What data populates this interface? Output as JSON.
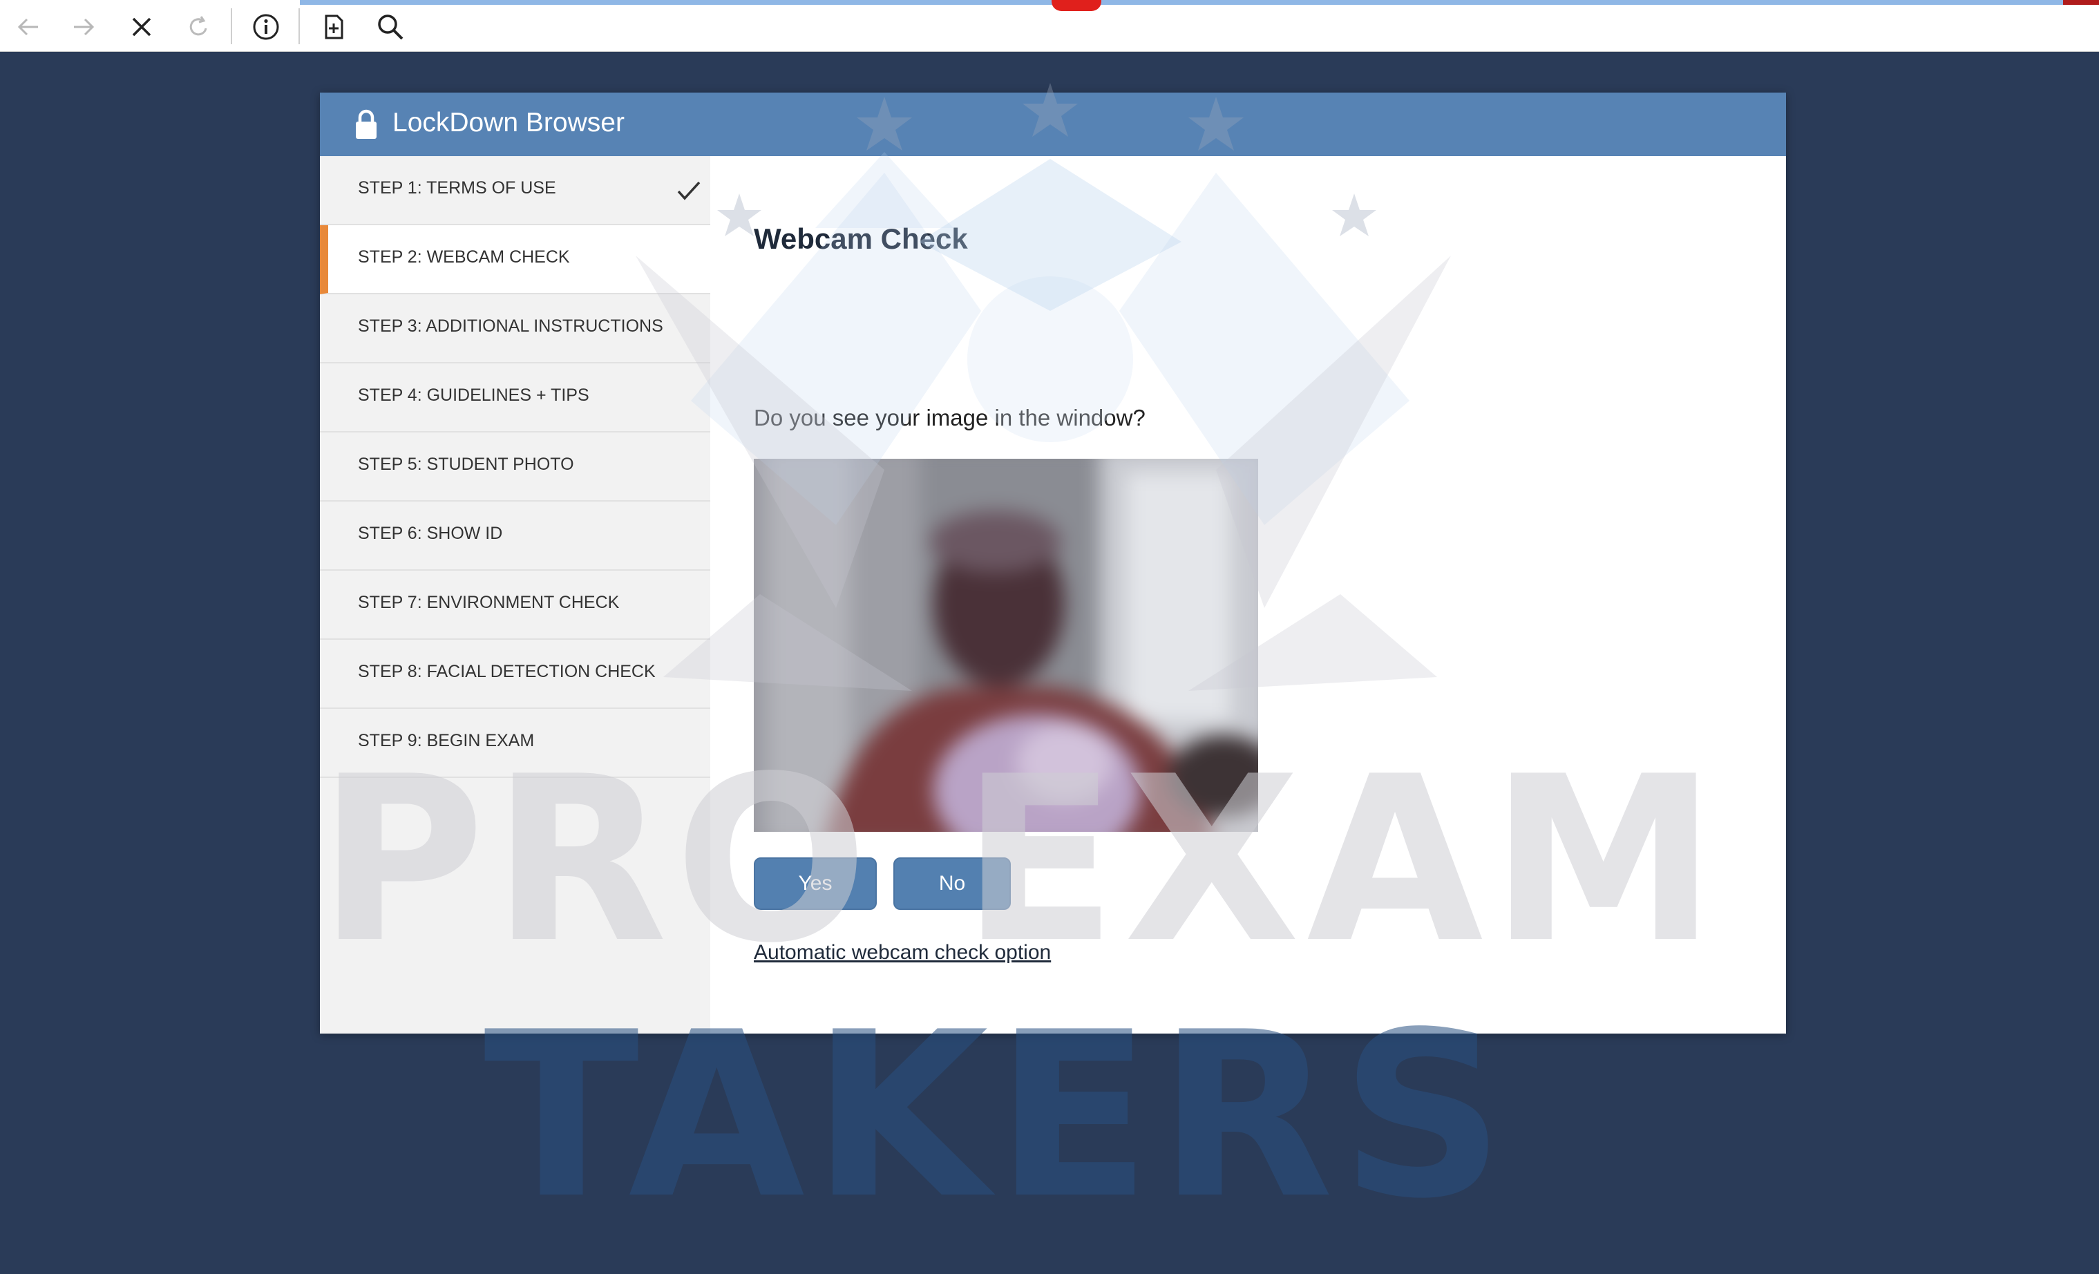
{
  "browser": {
    "buttons": [
      {
        "name": "back-icon"
      },
      {
        "name": "forward-icon"
      },
      {
        "name": "stop-icon"
      },
      {
        "name": "reload-icon"
      },
      {
        "name": "info-icon"
      },
      {
        "name": "add-page-icon"
      },
      {
        "name": "search-icon"
      }
    ]
  },
  "dialog": {
    "title": "LockDown Browser"
  },
  "steps": [
    {
      "label": "STEP 1: TERMS OF USE",
      "completed": true
    },
    {
      "label": "STEP 2: WEBCAM CHECK",
      "active": true
    },
    {
      "label": "STEP 3: ADDITIONAL INSTRUCTIONS"
    },
    {
      "label": "STEP 4: GUIDELINES + TIPS"
    },
    {
      "label": "STEP 5: STUDENT PHOTO"
    },
    {
      "label": "STEP 6: SHOW ID"
    },
    {
      "label": "STEP 7: ENVIRONMENT CHECK"
    },
    {
      "label": "STEP 8: FACIAL DETECTION CHECK"
    },
    {
      "label": "STEP 9: BEGIN EXAM"
    }
  ],
  "main": {
    "title": "Webcam Check",
    "question": "Do you see your image in the window?",
    "yes_label": "Yes",
    "no_label": "No",
    "auto_link": "Automatic webcam check option"
  },
  "watermark": {
    "line1": "PRO EXAM",
    "line2": "TAKERS"
  },
  "colors": {
    "page_background": "#2a3b58",
    "header": "#5783b4",
    "button": "#5380b0",
    "active_step_accent": "#e8893a"
  }
}
